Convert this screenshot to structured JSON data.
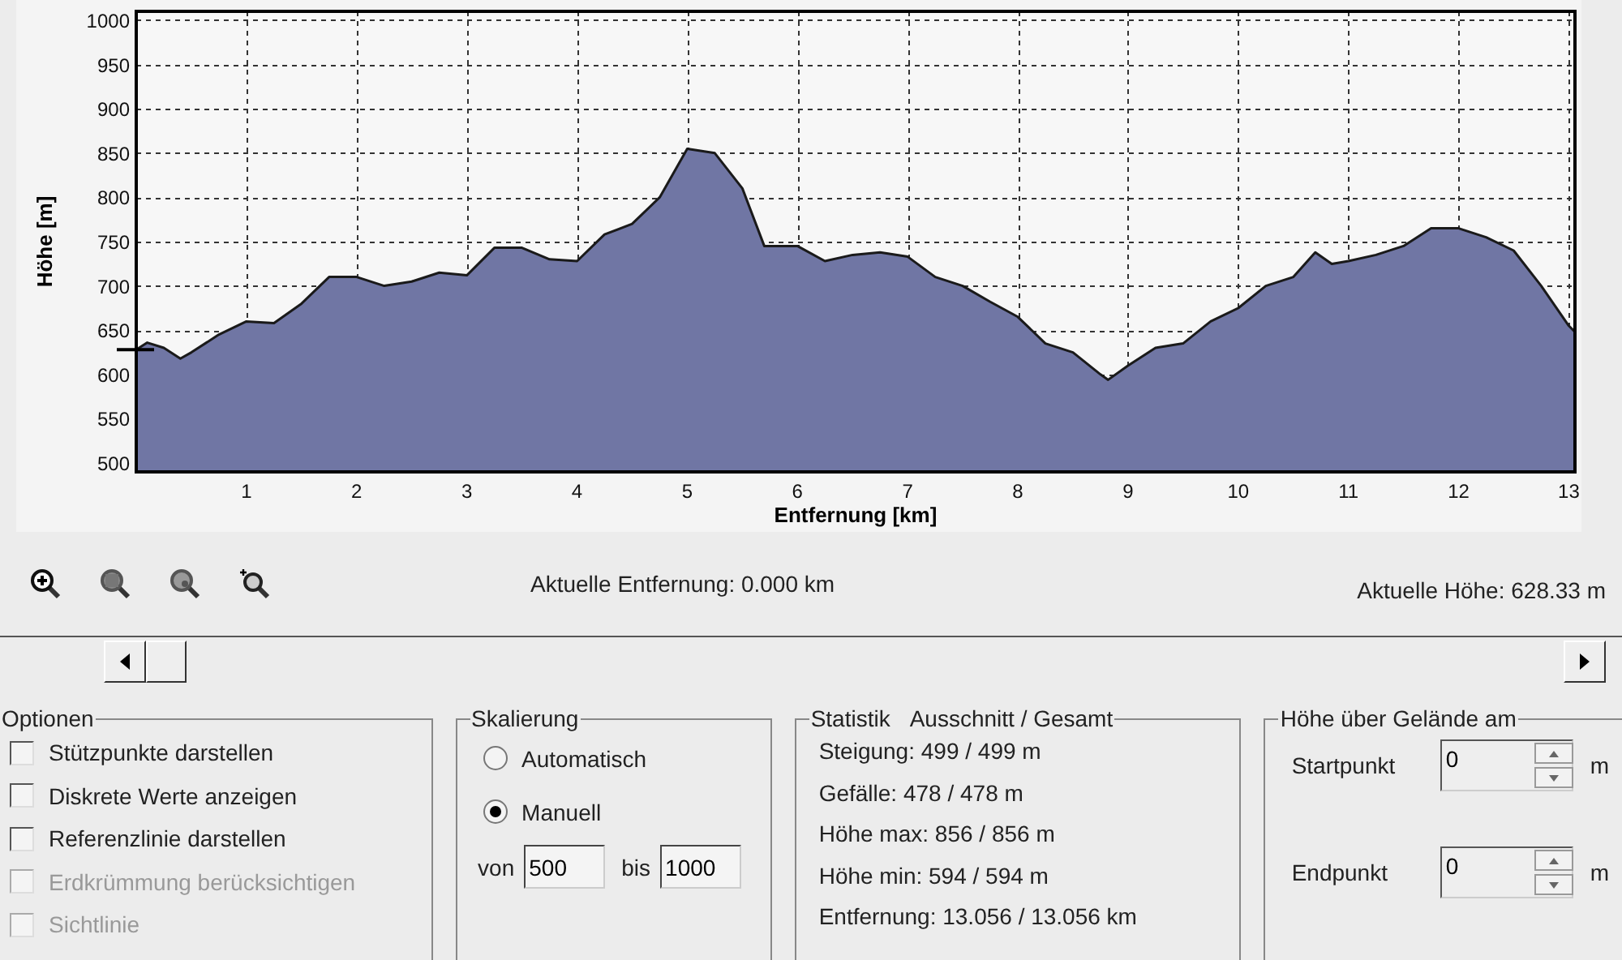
{
  "chart": {
    "chart_data": {
      "type": "area",
      "xlabel": "Entfernung [km]",
      "ylabel": "Höhe [m]",
      "x": [
        0,
        0.1,
        0.25,
        0.4,
        0.5,
        0.75,
        1.0,
        1.25,
        1.5,
        1.75,
        2.0,
        2.25,
        2.5,
        2.75,
        3.0,
        3.25,
        3.5,
        3.75,
        4.0,
        4.25,
        4.5,
        4.75,
        5.0,
        5.25,
        5.5,
        5.7,
        6.0,
        6.25,
        6.5,
        6.75,
        7.0,
        7.25,
        7.5,
        7.75,
        8.0,
        8.25,
        8.5,
        8.75,
        8.82,
        9.0,
        9.25,
        9.5,
        9.75,
        10.0,
        10.25,
        10.5,
        10.7,
        10.85,
        11.0,
        11.25,
        11.5,
        11.75,
        12.0,
        12.25,
        12.5,
        12.75,
        13.0,
        13.056
      ],
      "grid": true,
      "series": [
        {
          "color": "#7076a4",
          "values": [
            628,
            636,
            630,
            618,
            625,
            645,
            660,
            658,
            680,
            710,
            710,
            700,
            705,
            715,
            712,
            743,
            743,
            730,
            728,
            758,
            770,
            800,
            855,
            850,
            810,
            745,
            745,
            728,
            735,
            738,
            733,
            710,
            700,
            682,
            665,
            635,
            625,
            600,
            594,
            610,
            630,
            635,
            660,
            675,
            700,
            710,
            738,
            725,
            728,
            735,
            745,
            765,
            765,
            755,
            740,
            700,
            655,
            648
          ]
        }
      ],
      "xlim": [
        0,
        13.056
      ],
      "ylim": [
        490,
        1010
      ],
      "xticks": [
        1,
        2,
        3,
        4,
        5,
        6,
        7,
        8,
        9,
        10,
        11,
        12,
        13
      ],
      "yticks": [
        500,
        550,
        600,
        650,
        700,
        750,
        800,
        850,
        900,
        950,
        1000
      ]
    }
  },
  "status": {
    "distance": "Aktuelle Entfernung: 0.000 km",
    "height": "Aktuelle Höhe: 628.33 m"
  },
  "options": {
    "title": "Optionen",
    "items": [
      {
        "label": "Stützpunkte darstellen",
        "checked": false,
        "disabled": false
      },
      {
        "label": "Diskrete Werte anzeigen",
        "checked": false,
        "disabled": false
      },
      {
        "label": "Referenzlinie darstellen",
        "checked": false,
        "disabled": false
      },
      {
        "label": "Erdkrümmung berücksichtigen",
        "checked": false,
        "disabled": true
      },
      {
        "label": "Sichtlinie",
        "checked": false,
        "disabled": true
      }
    ]
  },
  "scaling": {
    "title": "Skalierung",
    "modes": [
      {
        "label": "Automatisch",
        "selected": false
      },
      {
        "label": "Manuell",
        "selected": true
      }
    ],
    "from_label": "von",
    "from": "500",
    "to_label": "bis",
    "to": "1000"
  },
  "statistics": {
    "title": "Statistik",
    "subtitle": "Ausschnitt / Gesamt",
    "lines": [
      "Steigung: 499 / 499 m",
      "Gefälle: 478 / 478 m",
      "Höhe max: 856 / 856 m",
      "Höhe min: 594 / 594 m",
      "Entfernung: 13.056 / 13.056 km"
    ]
  },
  "height_above_ground": {
    "title": "Höhe über Gelände am",
    "fields": [
      {
        "label": "Startpunkt",
        "value": "0",
        "unit": "m"
      },
      {
        "label": "Endpunkt",
        "value": "0",
        "unit": "m"
      }
    ]
  }
}
